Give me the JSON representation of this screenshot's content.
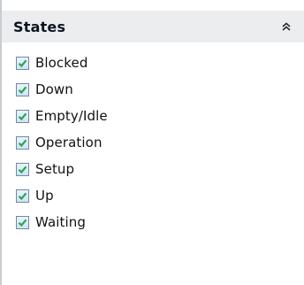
{
  "panel": {
    "title": "States",
    "collapse_icon": "double-chevron-up-icon"
  },
  "states": [
    {
      "label": "Blocked",
      "checked": true
    },
    {
      "label": "Down",
      "checked": true
    },
    {
      "label": "Empty/Idle",
      "checked": true
    },
    {
      "label": "Operation",
      "checked": true
    },
    {
      "label": "Setup",
      "checked": true
    },
    {
      "label": "Up",
      "checked": true
    },
    {
      "label": "Waiting",
      "checked": true
    }
  ],
  "colors": {
    "check_mark": "#2ea44f",
    "header_bg": "#ecedef",
    "checkbox_border": "#6f8aa3"
  }
}
